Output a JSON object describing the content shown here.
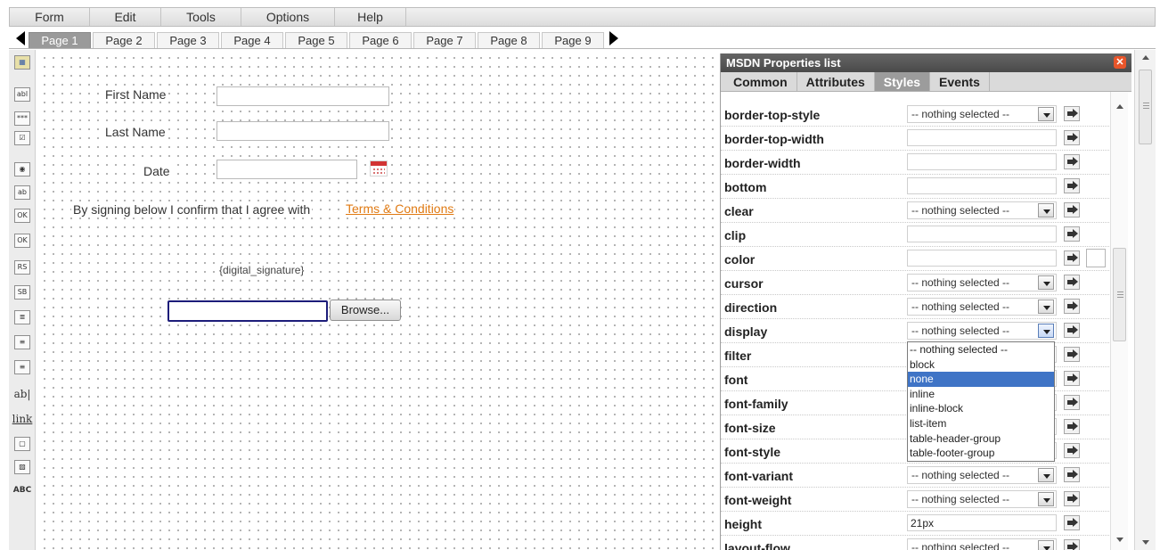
{
  "menu": [
    "Form",
    "Edit",
    "Tools",
    "Options",
    "Help"
  ],
  "pages": [
    "Page 1",
    "Page 2",
    "Page 3",
    "Page 4",
    "Page 5",
    "Page 6",
    "Page 7",
    "Page 8",
    "Page 9"
  ],
  "active_page": "Page 1",
  "toolbox": [
    {
      "name": "form-properties-tool-icon",
      "glyph": "▦"
    },
    {
      "name": "textbox-tool-icon",
      "glyph": "abl"
    },
    {
      "name": "password-tool-icon",
      "glyph": "***"
    },
    {
      "name": "checkbox-tool-icon",
      "glyph": "☑"
    },
    {
      "name": "radio-tool-icon",
      "glyph": "◉"
    },
    {
      "name": "combobox-tool-icon",
      "glyph": "ab"
    },
    {
      "name": "button1-tool-icon",
      "glyph": "OK"
    },
    {
      "name": "button2-tool-icon",
      "glyph": "OK"
    },
    {
      "name": "reset-button-tool-icon",
      "glyph": "RS"
    },
    {
      "name": "submit-button-tool-icon",
      "glyph": "SB"
    },
    {
      "name": "listbox-tool-icon",
      "glyph": "≣"
    },
    {
      "name": "list-tool-icon",
      "glyph": "≡"
    },
    {
      "name": "list2-tool-icon",
      "glyph": "≡"
    },
    {
      "name": "label-tool-icon",
      "glyph": "ab|"
    },
    {
      "name": "link-tool-icon",
      "glyph": "link"
    },
    {
      "name": "panel-tool-icon",
      "glyph": "▢"
    },
    {
      "name": "image-tool-icon",
      "glyph": "▨"
    },
    {
      "name": "spellcheck-tool-icon",
      "glyph": "ABC"
    }
  ],
  "form": {
    "first_name_label": "First Name",
    "last_name_label": "Last Name",
    "date_label": "Date",
    "agreement_text": "By signing below I confirm that I agree with",
    "terms_link": "Terms & Conditions",
    "signature_placeholder": "{digital_signature}",
    "browse_button": "Browse..."
  },
  "panel": {
    "title": "MSDN Properties list",
    "tabs": [
      "Common",
      "Attributes",
      "Styles",
      "Events"
    ],
    "active_tab": "Styles",
    "properties": [
      {
        "name": "border-top-style",
        "type": "select",
        "value": "-- nothing selected --"
      },
      {
        "name": "border-top-width",
        "type": "text",
        "value": ""
      },
      {
        "name": "border-width",
        "type": "text",
        "value": ""
      },
      {
        "name": "bottom",
        "type": "text",
        "value": ""
      },
      {
        "name": "clear",
        "type": "select",
        "value": "-- nothing selected --"
      },
      {
        "name": "clip",
        "type": "text",
        "value": ""
      },
      {
        "name": "color",
        "type": "text",
        "value": ""
      },
      {
        "name": "cursor",
        "type": "select",
        "value": "-- nothing selected --"
      },
      {
        "name": "direction",
        "type": "select",
        "value": "-- nothing selected --"
      },
      {
        "name": "display",
        "type": "select",
        "value": "-- nothing selected --"
      },
      {
        "name": "filter",
        "type": "text",
        "value": ""
      },
      {
        "name": "font",
        "type": "text",
        "value": ""
      },
      {
        "name": "font-family",
        "type": "text",
        "value": ""
      },
      {
        "name": "font-size",
        "type": "text",
        "value": ""
      },
      {
        "name": "font-style",
        "type": "text",
        "value": ""
      },
      {
        "name": "font-variant",
        "type": "select",
        "value": "-- nothing selected --"
      },
      {
        "name": "font-weight",
        "type": "select",
        "value": "-- nothing selected --"
      },
      {
        "name": "height",
        "type": "text",
        "value": "21px"
      },
      {
        "name": "layout-flow",
        "type": "select",
        "value": "-- nothing selected --"
      }
    ],
    "display_dropdown_options": [
      "-- nothing selected --",
      "block",
      "none",
      "inline",
      "inline-block",
      "list-item",
      "table-header-group",
      "table-footer-group"
    ],
    "display_dropdown_highlighted": "none"
  },
  "colors": {
    "accent_link": "#e07a13",
    "selected_option": "#3f74c6",
    "panel_title_bg": "#555555",
    "close_icon": "#e8552a"
  }
}
